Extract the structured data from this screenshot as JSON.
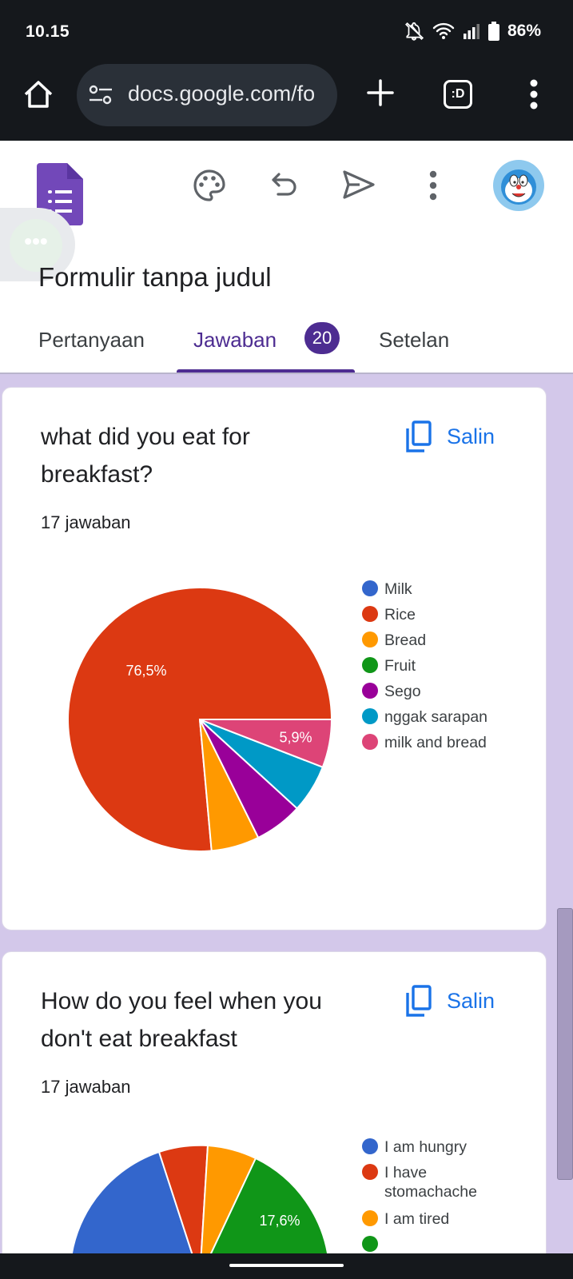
{
  "status_bar": {
    "time": "10.15",
    "battery": "86%"
  },
  "browser": {
    "url": "docs.google.com/fo",
    "tab_switcher_label": ":D"
  },
  "form": {
    "title": "Formulir tanpa judul",
    "tabs": [
      {
        "label": "Pertanyaan"
      },
      {
        "label": "Jawaban",
        "badge": "20"
      },
      {
        "label": "Setelan"
      }
    ],
    "accent_color": "#4d2c91"
  },
  "cards": [
    {
      "question": "what did you eat for breakfast?",
      "copy_label": "Salin",
      "response_count": "17 jawaban",
      "chart_data": {
        "type": "pie",
        "categories": [
          "Milk",
          "Rice",
          "Bread",
          "Fruit",
          "Sego",
          "nggak sarapan",
          "milk and bread"
        ],
        "values": [
          0,
          76.5,
          5.9,
          0,
          5.9,
          5.9,
          5.9
        ],
        "colors": [
          "#3366cc",
          "#dc3912",
          "#ff9900",
          "#109618",
          "#990099",
          "#0099c6",
          "#dd4477"
        ],
        "labels": {
          "Rice": "76,5%",
          "milk and bread": "5,9%"
        },
        "legend_position": "right"
      }
    },
    {
      "question": "How do you feel when you don't eat breakfast",
      "copy_label": "Salin",
      "response_count": "17 jawaban",
      "chart_data": {
        "type": "pie",
        "categories": [
          "I am hungry",
          "I have stomachache",
          "I am tired"
        ],
        "colors": [
          "#3366cc",
          "#dc3912",
          "#ff9900",
          "#109618"
        ],
        "labels": {
          "slice_4": "17,6%"
        },
        "legend_position": "right"
      }
    }
  ]
}
